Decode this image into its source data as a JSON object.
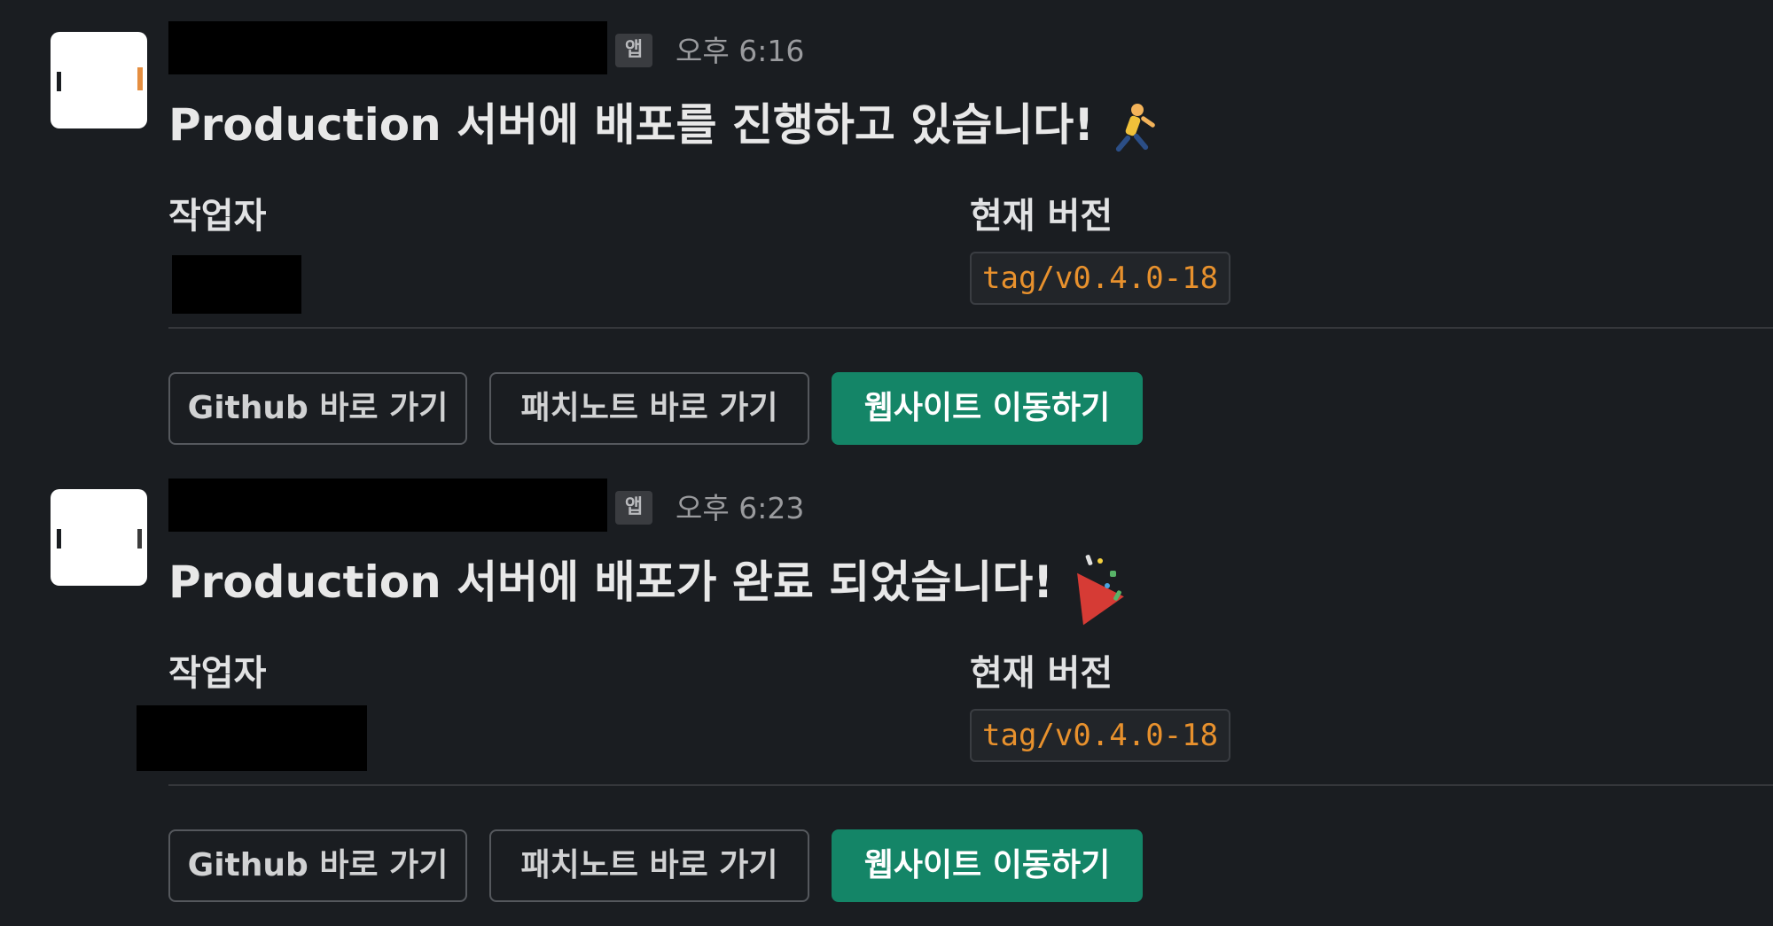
{
  "messages": [
    {
      "app_badge": "앱",
      "timestamp": "오후 6:16",
      "headline": "Production 서버에 배포를 진행하고 있습니다!",
      "headline_emoji": "runner-emoji",
      "author_label": "작업자",
      "version_label": "현재 버전",
      "version_value": "tag/v0.4.0-18",
      "buttons": {
        "github": "Github 바로 가기",
        "patchnote": "패치노트 바로 가기",
        "website": "웹사이트 이동하기"
      }
    },
    {
      "app_badge": "앱",
      "timestamp": "오후 6:23",
      "headline": "Production 서버에 배포가 완료 되었습니다!",
      "headline_emoji": "party-popper-emoji",
      "author_label": "작업자",
      "version_label": "현재 버전",
      "version_value": "tag/v0.4.0-18",
      "buttons": {
        "github": "Github 바로 가기",
        "patchnote": "패치노트 바로 가기",
        "website": "웹사이트 이동하기"
      }
    }
  ],
  "colors": {
    "background": "#1a1d21",
    "primary_button": "#148567",
    "version_text": "#e8912d"
  }
}
